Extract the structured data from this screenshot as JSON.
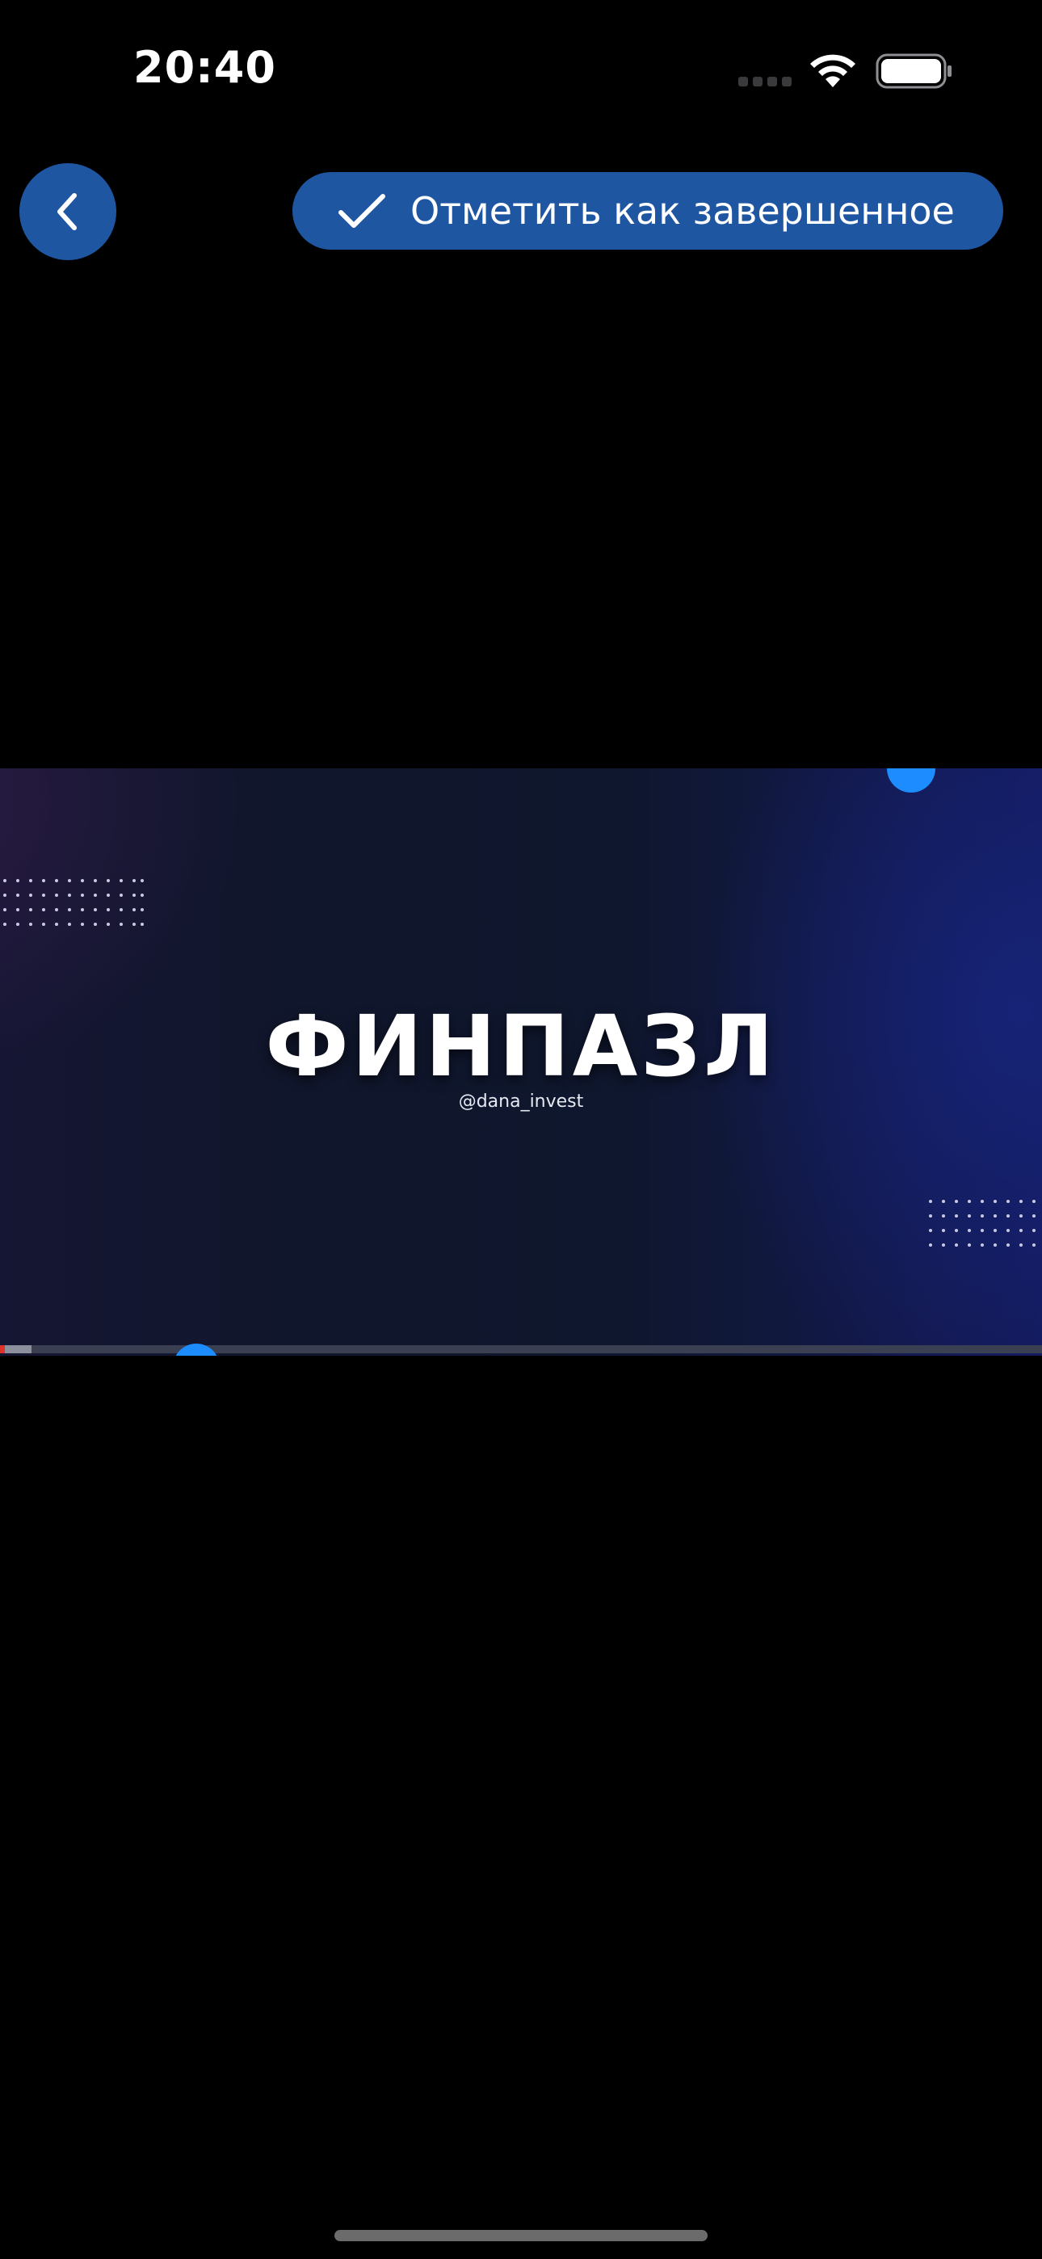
{
  "status_bar": {
    "time": "20:40",
    "wifi_icon": "wifi-icon",
    "battery_icon": "battery-icon"
  },
  "header": {
    "back_icon": "chevron-left-icon",
    "complete_button": {
      "icon": "checkmark-icon",
      "label": "Отметить как завершенное"
    }
  },
  "video": {
    "title": "ФИНПАЗЛ",
    "handle": "@dana_invest",
    "progress": {
      "played_fraction": 0.005,
      "buffered_fraction": 0.03
    }
  },
  "colors": {
    "accent": "#1e56a2",
    "knob": "#1c8cff",
    "played": "#e0302a",
    "background": "#000000"
  }
}
